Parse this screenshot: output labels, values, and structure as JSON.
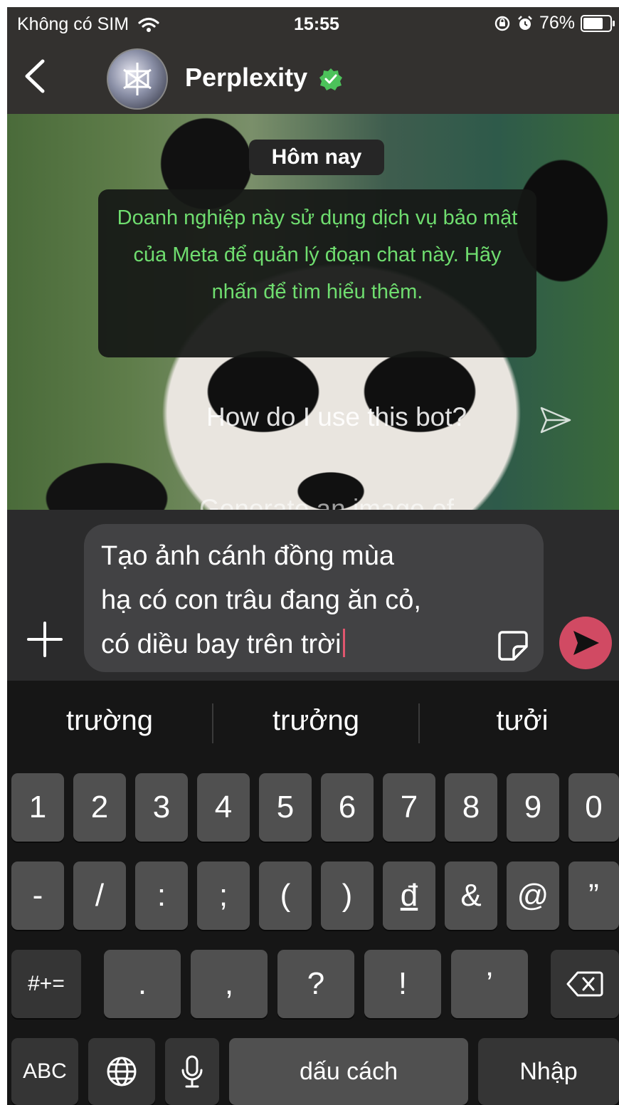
{
  "status_bar": {
    "carrier": "Không có SIM",
    "time": "15:55",
    "battery_percent": "76%",
    "battery_level": 0.76
  },
  "header": {
    "title": "Perplexity",
    "back_icon": "chevron-left-icon",
    "verified_icon": "verified-badge-icon"
  },
  "chat": {
    "day_label": "Hôm nay",
    "notice_text": "Doanh nghiệp này sử dụng dịch vụ bảo mật của Meta để quản lý đoạn chat này. Hãy nhấn để tìm hiểu thêm.",
    "suggestion_1": "How do I use this bot?",
    "suggestion_2": "Generate an image of"
  },
  "composer": {
    "text_line_1": "Tạo ảnh cánh đồng mùa",
    "text_line_2": "hạ có con trâu đang ăn cỏ,",
    "text_line_3": "có diều bay trên trời"
  },
  "keyboard": {
    "predictions": [
      "trường",
      "trưởng",
      "tưởi"
    ],
    "row_numbers": [
      "1",
      "2",
      "3",
      "4",
      "5",
      "6",
      "7",
      "8",
      "9",
      "0"
    ],
    "row_symbols": [
      "-",
      "/",
      ":",
      ";",
      "(",
      ")",
      "đ",
      "&",
      "@",
      "”"
    ],
    "row_punct": [
      "#+=",
      ".",
      ",",
      "?",
      "!",
      "’"
    ],
    "abc_label": "ABC",
    "space_label": "dấu cách",
    "return_label": "Nhập"
  },
  "colors": {
    "header_bg": "#33312f",
    "notice_text": "#6fdd6f",
    "send_button": "#d14a63",
    "caret": "#e0566e",
    "verified": "#4cc25a"
  }
}
